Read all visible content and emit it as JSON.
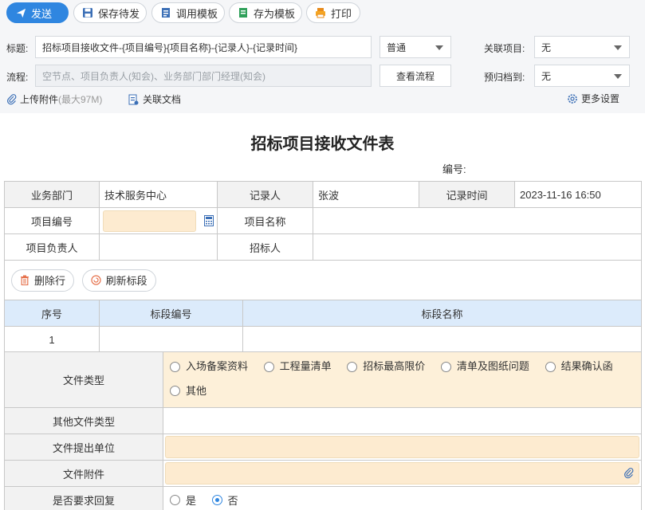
{
  "toolbar": {
    "send": "发送",
    "save_draft": "保存待发",
    "use_template": "调用模板",
    "save_template": "存为模板",
    "print": "打印"
  },
  "header": {
    "title_label": "标题:",
    "title_value": "招标项目接收文件-{项目编号}{项目名称}-{记录人}-{记录时间}",
    "priority_value": "普通",
    "related_project_label": "关联项目:",
    "related_project_value": "无",
    "flow_label": "流程:",
    "flow_placeholder": "空节点、项目负责人(知会)、业务部门部门经理(知会)",
    "view_flow": "查看流程",
    "archive_label": "预归档到:",
    "archive_value": "无",
    "upload_attachment": "上传附件",
    "upload_limit": "(最大97M)",
    "related_docs": "关联文档",
    "more_settings": "更多设置"
  },
  "form": {
    "title": "招标项目接收文件表",
    "code_label": "编号:",
    "dept_label": "业务部门",
    "dept_value": "技术服务中心",
    "recorder_label": "记录人",
    "recorder_value": "张波",
    "record_time_label": "记录时间",
    "record_time_value": "2023-11-16 16:50",
    "project_no_label": "项目编号",
    "project_name_label": "项目名称",
    "project_lead_label": "项目负责人",
    "tenderer_label": "招标人",
    "delete_row": "删除行",
    "refresh_section": "刷新标段",
    "col_seq": "序号",
    "col_section_no": "标段编号",
    "col_section_name": "标段名称",
    "rows": [
      {
        "seq": "1",
        "section_no": "",
        "section_name": ""
      }
    ],
    "file_type_label": "文件类型",
    "file_types": [
      "入场备案资料",
      "工程量清单",
      "招标最高限价",
      "清单及图纸问题",
      "结果确认函",
      "其他"
    ],
    "other_type_label": "其他文件类型",
    "submit_unit_label": "文件提出单位",
    "attachment_label": "文件附件",
    "reply_label": "是否要求回复",
    "reply_yes": "是",
    "reply_no": "否",
    "reply_selected": "否"
  },
  "colors": {
    "primary": "#2f86e0",
    "highlight_field": "#fdebd0",
    "table_header_blue": "#dcebfb"
  }
}
